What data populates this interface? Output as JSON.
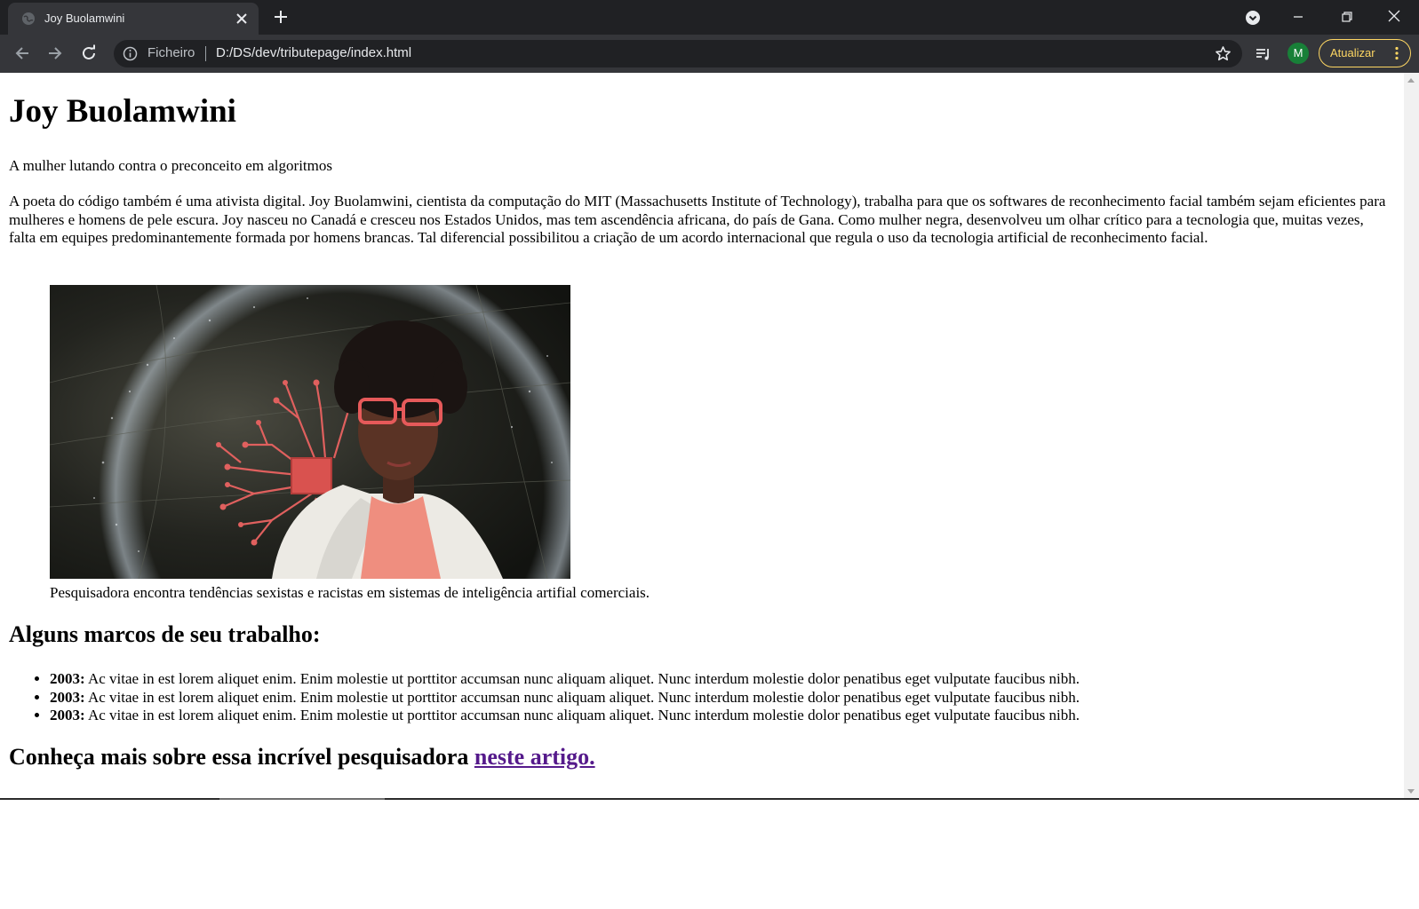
{
  "browser": {
    "tab_title": "Joy Buolamwini",
    "scheme_label": "Ficheiro",
    "url": "D:/DS/dev/tributepage/index.html",
    "profile_initial": "M",
    "update_label": "Atualizar"
  },
  "page": {
    "title": "Joy Buolamwini",
    "subtitle": "A mulher lutando contra o preconceito em algoritmos",
    "intro": "A poeta do código também é uma ativista digital. Joy Buolamwini, cientista da computação do MIT (Massachusetts Institute of Technology), trabalha para que os softwares de reconhecimento facial também sejam eficientes para mulheres e homens de pele escura. Joy nasceu no Canadá e cresceu nos Estados Unidos, mas tem ascendência africana, do país de Gana. Como mulher negra, desenvolveu um olhar crítico para a tecnologia que, muitas vezes, falta em equipes predominantemente formada por homens brancas. Tal diferencial possibilitou a criação de um acordo internacional que regula o uso da tecnologia artificial de reconhecimento facial.",
    "caption": "Pesquisadora encontra tendências sexistas e racistas em sistemas de inteligência artifial comerciais.",
    "milestones_heading": "Alguns marcos de seu trabalho:",
    "milestones": [
      {
        "year": "2003:",
        "text": " Ac vitae in est lorem aliquet enim. Enim molestie ut porttitor accumsan nunc aliquam aliquet. Nunc interdum molestie dolor penatibus eget vulputate faucibus nibh."
      },
      {
        "year": "2003:",
        "text": " Ac vitae in est lorem aliquet enim. Enim molestie ut porttitor accumsan nunc aliquam aliquet. Nunc interdum molestie dolor penatibus eget vulputate faucibus nibh."
      },
      {
        "year": "2003:",
        "text": " Ac vitae in est lorem aliquet enim. Enim molestie ut porttitor accumsan nunc aliquam aliquet. Nunc interdum molestie dolor penatibus eget vulputate faucibus nibh."
      }
    ],
    "more_text": "Conheça mais sobre essa incrível pesquisadora ",
    "more_link": "neste artigo."
  },
  "colors": {
    "chrome_dark": "#202124",
    "chrome_toolbar": "#35363a",
    "update_accent": "#fdd663",
    "visited_link": "#551a8b"
  }
}
